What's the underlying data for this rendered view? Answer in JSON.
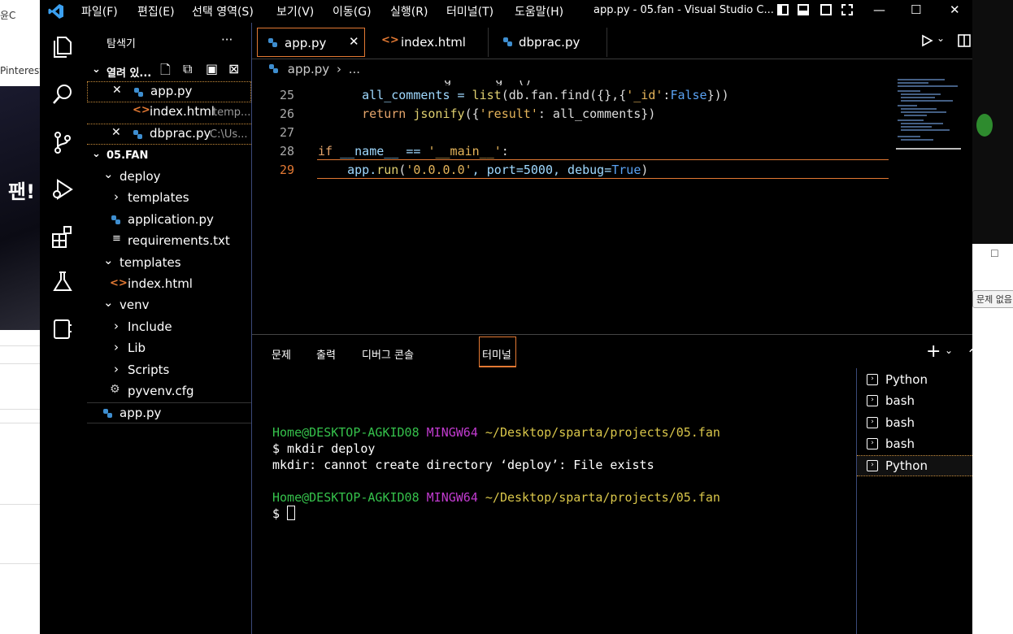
{
  "background": {
    "left_tab_text": "윤C",
    "left_bookmark": "Pinterest",
    "left_hero_text": "팬!",
    "right_pill": "문제 없음"
  },
  "titlebar": {
    "menus": [
      "파일(F)",
      "편집(E)",
      "선택 영역(S)",
      "보기(V)",
      "이동(G)",
      "실행(R)",
      "터미널(T)",
      "도움말(H)"
    ],
    "title": "app.py - 05.fan - Visual Studio C...",
    "minimize": "—",
    "maximize": "☐",
    "close": "✕"
  },
  "sidebar": {
    "title": "탐색기",
    "more": "···",
    "open_editors_label": "열려 있...",
    "open_editors": [
      {
        "name": "app.py",
        "desc": ""
      },
      {
        "name": "index.html",
        "desc": "temp..."
      },
      {
        "name": "dbprac.py",
        "desc": "C:\\Us..."
      }
    ],
    "folder_label": "05.FAN",
    "tree": [
      {
        "label": "deploy",
        "chev": "⌄"
      },
      {
        "label": "templates",
        "chev": "›"
      },
      {
        "label": "application.py",
        "chev": ""
      },
      {
        "label": "requirements.txt",
        "chev": ""
      },
      {
        "label": "templates",
        "chev": "⌄"
      },
      {
        "label": "index.html",
        "chev": ""
      },
      {
        "label": "venv",
        "chev": "⌄"
      },
      {
        "label": "Include",
        "chev": "›"
      },
      {
        "label": "Lib",
        "chev": "›"
      },
      {
        "label": "Scripts",
        "chev": "›"
      },
      {
        "label": "pyvenv.cfg",
        "chev": ""
      },
      {
        "label": "app.py",
        "chev": ""
      }
    ]
  },
  "editor": {
    "tabs": [
      {
        "label": "app.py",
        "close": "✕"
      },
      {
        "label": "index.html",
        "close": ""
      },
      {
        "label": "dbprac.py",
        "close": ""
      }
    ],
    "breadcrumb_file": "app.py",
    "breadcrumb_more": "...",
    "lines": [
      "25",
      "26",
      "27",
      "28",
      "29"
    ],
    "code": {
      "l25_a": "    all_comments = ",
      "l25_b": "list",
      "l25_c": "(db.fan.find({},{",
      "l25_d": "'_id'",
      "l25_e": ":",
      "l25_f": "False",
      "l25_g": "}))",
      "l26_a": "    ",
      "l26_b": "return",
      "l26_c": " ",
      "l26_d": "jsonify",
      "l26_e": "({",
      "l26_f": "'result'",
      "l26_g": ": all_comments})",
      "l28_a": "if",
      "l28_b": " __name__ == ",
      "l28_c": "'__main__'",
      "l28_d": ":",
      "l29_a": "    app.",
      "l29_b": "run",
      "l29_c": "(",
      "l29_d": "'0.0.0.0'",
      "l29_e": ", port=5000, debug=",
      "l29_f": "True",
      "l29_g": ")"
    }
  },
  "panel": {
    "tabs": [
      "문제",
      "출력",
      "디버그 콘솔",
      "터미널"
    ],
    "add": "+",
    "dropdown": "⌄",
    "maximize": "⌃",
    "close": "✕",
    "terminal": {
      "prompt1_user": "Home@DESKTOP-AGKID08",
      "prompt1_sys": "MINGW64",
      "prompt1_path": "~/Desktop/sparta/projects/05.fan",
      "cmd1": "$ mkdir deploy",
      "out1": "mkdir: cannot create directory ‘deploy’: File exists",
      "prompt2_user": "Home@DESKTOP-AGKID08",
      "prompt2_sys": "MINGW64",
      "prompt2_path": "~/Desktop/sparta/projects/05.fan",
      "cmd2": "$ "
    },
    "terminals": [
      "Python",
      "bash",
      "bash",
      "bash",
      "Python"
    ]
  },
  "colors": {
    "accent": "#e37933",
    "keyword": "#e5a56b",
    "string": "#e5b45a",
    "constant": "#5aa2f2",
    "prompt_green": "#35c14b",
    "prompt_magenta": "#c23bd0",
    "prompt_yellow": "#d9c64a"
  }
}
